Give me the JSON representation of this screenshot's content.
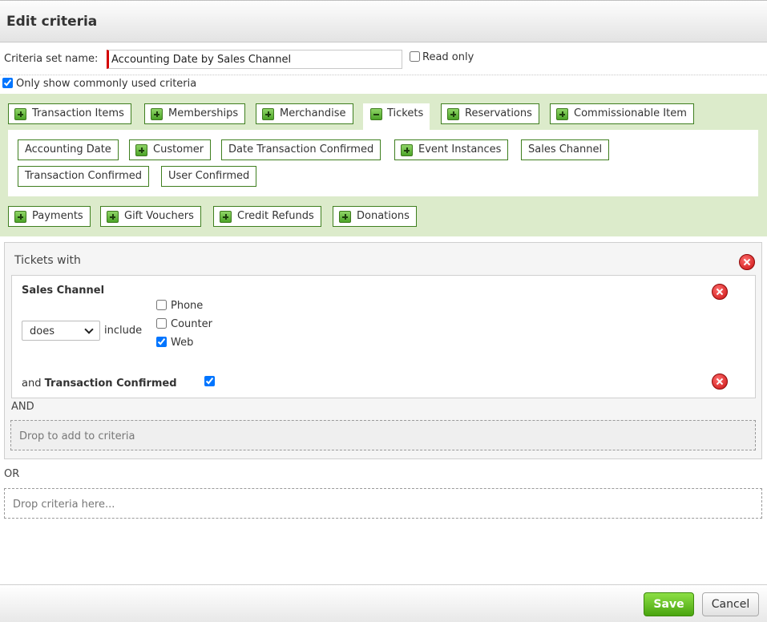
{
  "dialog": {
    "title": "Edit criteria"
  },
  "form": {
    "criteria_set_name_label": "Criteria set name:",
    "criteria_set_name_value": "Accounting Date by Sales Channel",
    "read_only_label": "Read only",
    "read_only_checked": false,
    "common_only_label": "Only show commonly used criteria",
    "common_only_checked": true
  },
  "categories": {
    "row1": [
      {
        "label": "Transaction Items",
        "expanded": false
      },
      {
        "label": "Memberships",
        "expanded": false
      },
      {
        "label": "Merchandise",
        "expanded": false
      },
      {
        "label": "Tickets",
        "expanded": true
      },
      {
        "label": "Reservations",
        "expanded": false
      },
      {
        "label": "Commissionable Item",
        "expanded": false
      }
    ],
    "ticket_fields": [
      {
        "label": "Accounting Date",
        "expandable": false
      },
      {
        "label": "Customer",
        "expandable": true
      },
      {
        "label": "Date Transaction Confirmed",
        "expandable": false
      },
      {
        "label": "Event Instances",
        "expandable": true
      },
      {
        "label": "Sales Channel",
        "expandable": false
      },
      {
        "label": "Transaction Confirmed",
        "expandable": false
      },
      {
        "label": "User Confirmed",
        "expandable": false
      }
    ],
    "row2": [
      {
        "label": "Payments",
        "expanded": false
      },
      {
        "label": "Gift Vouchers",
        "expanded": false
      },
      {
        "label": "Credit Refunds",
        "expanded": false
      },
      {
        "label": "Donations",
        "expanded": false
      }
    ]
  },
  "criteria": {
    "group_title": "Tickets with",
    "sales_channel": {
      "title": "Sales Channel",
      "operator": "does",
      "verb": "include",
      "options": [
        {
          "label": "Phone",
          "checked": false
        },
        {
          "label": "Counter",
          "checked": false
        },
        {
          "label": "Web",
          "checked": true
        }
      ]
    },
    "transaction_confirmed": {
      "prefix": "and",
      "title": "Transaction Confirmed",
      "checked": true
    },
    "and_label": "AND",
    "drop_inner_placeholder": "Drop to add to criteria",
    "or_label": "OR",
    "drop_outer_placeholder": "Drop criteria here..."
  },
  "footer": {
    "save_label": "Save",
    "cancel_label": "Cancel"
  }
}
